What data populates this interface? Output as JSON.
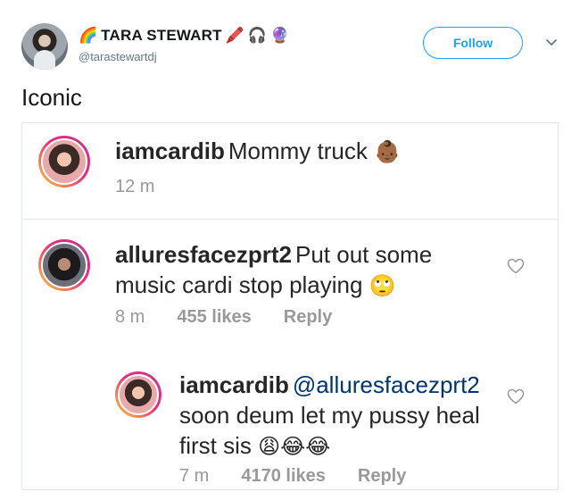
{
  "tweet": {
    "author": {
      "display_name": "TARA STEWART",
      "handle": "@tarastewartdj",
      "name_emojis": [
        "🌈",
        "🖍️",
        "🎧",
        "🔮"
      ]
    },
    "follow_label": "Follow",
    "text": "Iconic",
    "embedded_post": {
      "caption": {
        "username": "iamcardib",
        "text": "Mommy truck",
        "emoji": "👶🏾",
        "time": "12 m"
      },
      "comments": [
        {
          "username": "alluresfacezprt2",
          "line1": "Put out some",
          "line2": "music cardi stop playing",
          "emoji": "🙄",
          "time": "8 m",
          "likes": "455 likes",
          "reply": "Reply"
        },
        {
          "username": "iamcardib",
          "mention": "@alluresfacezprt2",
          "line1": "soon deum let my pussy heal",
          "line2": "first sis",
          "emoji": "😩😂😂",
          "time": "7 m",
          "likes": "4170 likes",
          "reply": "Reply"
        }
      ]
    }
  },
  "colors": {
    "accent": "#1da1f2",
    "meta_gray": "#999999",
    "mention": "#003569"
  }
}
